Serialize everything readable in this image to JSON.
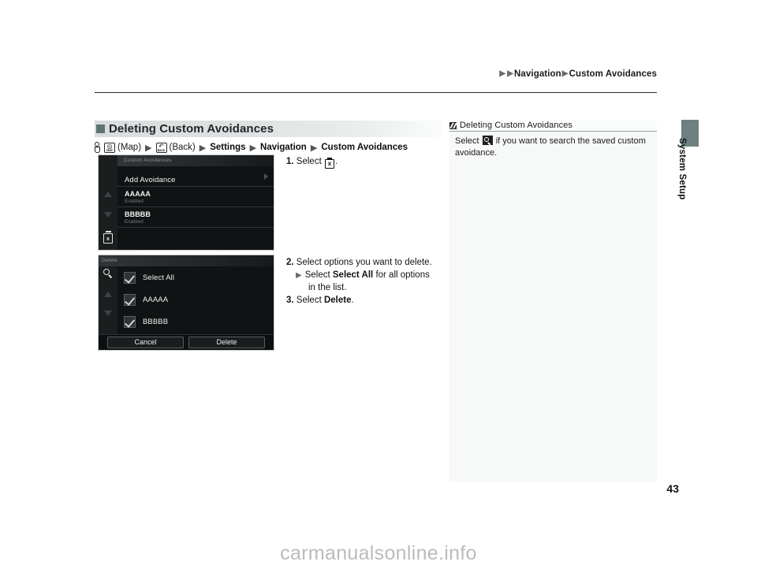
{
  "breadcrumb": {
    "items": [
      "Navigation",
      "Custom Avoidances"
    ]
  },
  "side_tab": {
    "label": "System Setup",
    "color": "#6e8080"
  },
  "section": {
    "title": "Deleting Custom Avoidances",
    "marker_color": "#5e7272"
  },
  "nav_path": {
    "hand_icon": "hand-pointer-icon",
    "map_button": {
      "icon": "map-button-icon",
      "glyph": "◎",
      "sub": "MAP",
      "label": "(Map)"
    },
    "back_button": {
      "icon": "back-button-icon",
      "glyph": "↰",
      "sub": "BACK",
      "label": "(Back)"
    },
    "steps": [
      "Settings",
      "Navigation",
      "Custom Avoidances"
    ],
    "separator": "▶"
  },
  "screenshot_1": {
    "name": "custom-avoidances-screen",
    "title": "Custom Avoidances",
    "rail": {
      "up_icon": "scroll-up-arrow-icon",
      "down_icon": "scroll-down-arrow-icon",
      "trash_icon": "delete-trash-icon",
      "trash_glyph": "x"
    },
    "rows": [
      {
        "label": "Add Avoidance",
        "sub": "",
        "chevron": true,
        "bold": false
      },
      {
        "label": "AAAAA",
        "sub": "Enabled",
        "chevron": false,
        "bold": true
      },
      {
        "label": "BBBBB",
        "sub": "Enabled",
        "chevron": false,
        "bold": true
      }
    ]
  },
  "screenshot_2": {
    "name": "delete-selection-screen",
    "title": "Delete",
    "rail": {
      "search_icon": "search-magnifier-icon",
      "up_icon": "scroll-up-arrow-icon",
      "down_icon": "scroll-down-arrow-icon"
    },
    "checkbox_rows": [
      {
        "label": "Select All",
        "checked": true
      },
      {
        "label": "AAAAA",
        "checked": true
      },
      {
        "label": "BBBBB",
        "checked": true
      }
    ],
    "buttons": [
      {
        "label": "Cancel",
        "name": "cancel-button"
      },
      {
        "label": "Delete",
        "name": "delete-button"
      }
    ]
  },
  "steps": {
    "step1": {
      "num": "1.",
      "text_before": "Select",
      "icon": "delete-trash-icon",
      "icon_glyph": "x",
      "text_after": "."
    },
    "step2": {
      "num": "2.",
      "text": "Select options you want to delete."
    },
    "step2_sub": {
      "bullet": "▶",
      "before": "Select",
      "keyword": "Select All",
      "after": "for all options"
    },
    "step2_sub_cont": {
      "text": "in the list."
    },
    "step3": {
      "num": "3.",
      "before": "Select",
      "keyword": "Delete",
      "after": "."
    }
  },
  "note": {
    "marker": "chevron-double-right-icon",
    "title": "Deleting Custom Avoidances",
    "body_before": "Select",
    "body_icon": "search-magnifier-icon",
    "body_after": "if you want to search the saved custom avoidance."
  },
  "page": {
    "number": "43",
    "watermark": "carmanualsonline.info"
  }
}
